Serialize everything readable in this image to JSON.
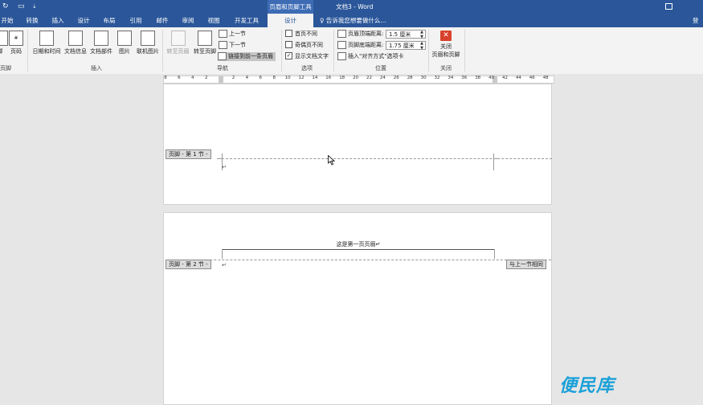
{
  "titlebar": {
    "contextual_title": "页眉和页脚工具",
    "doc_title": "文档3 - Word"
  },
  "tabs": [
    {
      "label": "开始"
    },
    {
      "label": "转换"
    },
    {
      "label": "插入"
    },
    {
      "label": "设计"
    },
    {
      "label": "布局"
    },
    {
      "label": "引用"
    },
    {
      "label": "邮件"
    },
    {
      "label": "审阅"
    },
    {
      "label": "视图"
    },
    {
      "label": "开发工具"
    },
    {
      "label": "设计"
    }
  ],
  "tell_me": "告诉我您想要做什么...",
  "login": "登",
  "ribbon": {
    "hf_group": {
      "label": "页脚",
      "buttons": [
        "脚",
        "页码"
      ]
    },
    "insert_group": {
      "label": "插入",
      "buttons": [
        "日期和时间",
        "文档信息",
        "文档部件",
        "图片",
        "联机图片"
      ]
    },
    "nav_group": {
      "label": "导航",
      "goto_header": "转至页眉",
      "goto_footer": "转至页脚",
      "prev": "上一节",
      "next": "下一节",
      "link_prev": "链接到前一条页眉"
    },
    "options_group": {
      "label": "选项",
      "first_page": "首页不同",
      "odd_even": "奇偶页不同",
      "show_text": "显示文档文字",
      "show_text_checked": "✓"
    },
    "position_group": {
      "label": "位置",
      "header_dist_label": "页眉顶端距离:",
      "header_dist_value": "1.5 厘米",
      "footer_dist_label": "页脚底端距离:",
      "footer_dist_value": "1.75 厘米",
      "insert_align_tab": "插入\"对齐方式\"选项卡"
    },
    "close_group": {
      "label": "关闭",
      "close_line1": "关闭",
      "close_line2": "页眉和页脚"
    }
  },
  "ruler": {
    "numbers": [
      "8",
      "6",
      "4",
      "2",
      "",
      "2",
      "4",
      "6",
      "8",
      "10",
      "12",
      "14",
      "16",
      "18",
      "20",
      "22",
      "24",
      "26",
      "28",
      "30",
      "32",
      "34",
      "36",
      "38",
      "40",
      "42",
      "44",
      "46",
      "48"
    ]
  },
  "document": {
    "page1": {
      "footer_tag": "页脚 - 第 1 节 -",
      "para_mark": "↵"
    },
    "page2": {
      "header_text": "这是第一页页眉↵",
      "footer_tag": "页脚 - 第 2 节 -",
      "same_as_prev": "与上一节相同",
      "para_mark": "↵"
    }
  },
  "watermark": "便民库"
}
